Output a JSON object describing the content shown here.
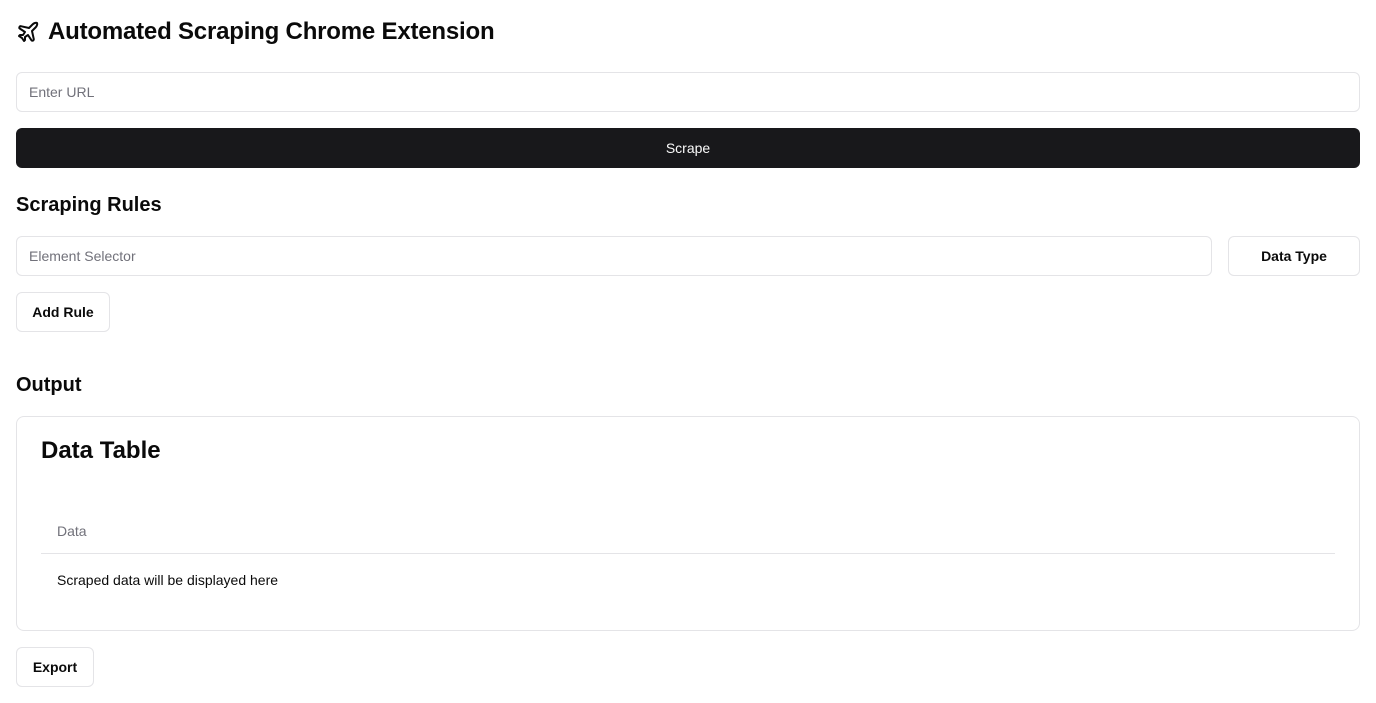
{
  "header": {
    "title": "Automated Scraping Chrome Extension",
    "icon": "plane-icon"
  },
  "url_input": {
    "placeholder": "Enter URL",
    "value": ""
  },
  "scrape_button": {
    "label": "Scrape"
  },
  "rules": {
    "title": "Scraping Rules",
    "selector_placeholder": "Element Selector",
    "selector_value": "",
    "data_type_label": "Data Type",
    "add_rule_label": "Add Rule"
  },
  "output": {
    "title": "Output",
    "card_title": "Data Table",
    "table": {
      "columns": [
        "Data"
      ],
      "rows": [
        [
          "Scraped data will be displayed here"
        ]
      ]
    },
    "export_label": "Export"
  },
  "colors": {
    "primary_button_bg": "#18181b",
    "border": "#e4e4e7",
    "muted_text": "#71717a"
  }
}
